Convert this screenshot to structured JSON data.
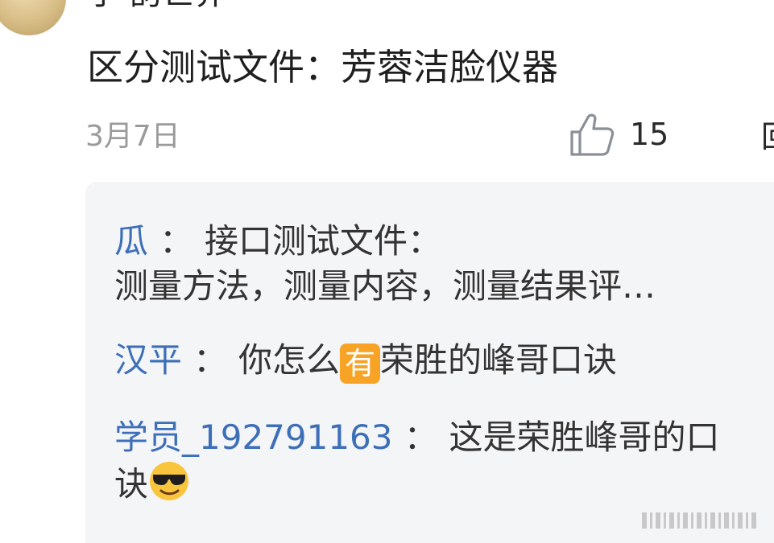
{
  "post": {
    "username": "于·韵世界",
    "comment_text": "区分测试文件：芳蓉洁脸仪器",
    "date": "3月7日",
    "like_count": "15",
    "reply_label": "回"
  },
  "replies": [
    {
      "name": "瓜",
      "separator": "：",
      "line1": "接口测试文件：",
      "line2": "测量方法，测量内容，测量结果评…"
    },
    {
      "name": "汉平",
      "separator": "：",
      "text_before": "你怎么",
      "emoji_label": "有",
      "text_after": "荣胜的峰哥口诀"
    },
    {
      "name": "学员_192791163",
      "separator": "：",
      "line1": "这是荣胜峰哥的口",
      "line2": "诀"
    }
  ],
  "colors": {
    "name_blue": "#3d6fb8",
    "reply_bg": "#f4f5f7",
    "date_gray": "#9a9a9a",
    "emoji_orange": "#f7a325"
  }
}
